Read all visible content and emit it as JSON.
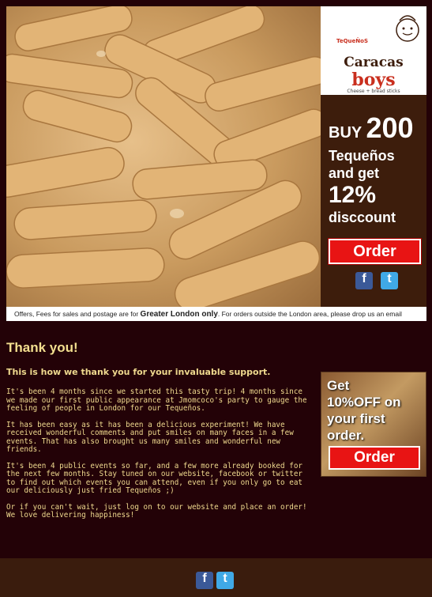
{
  "brand": {
    "tequenos_tag": "TeQueÑoS",
    "name_top": "Caracas",
    "name_bottom": "boys",
    "tagline": "Cheese + bread sticks"
  },
  "promo": {
    "buy": "BUY",
    "amount": "200",
    "product": "Tequeños",
    "and_get": "and get",
    "percent": "12%",
    "discount": "disccount",
    "order_label": "Order"
  },
  "social": {
    "facebook_glyph": "f",
    "twitter_glyph": "t"
  },
  "offer_note": {
    "before": "Offers, Fees for sales and postage are for ",
    "area": "Greater London only",
    "after": ". For orders outside the London area, please drop us an email"
  },
  "body": {
    "heading": "Thank you!",
    "lead": "This is how we thank you for your invaluable support.",
    "paragraphs": [
      "It's been 4 months since we started this tasty trip! 4 months since we made our first public appearance at Jmomcoco's party to gauge the feeling of people in London for our Tequeños.",
      "It has been easy as it has been a delicious experiment! We have received wonderful comments and put smiles on many faces in a few events. That has also brought us many smiles and wonderful new friends.",
      "It's been 4 public events so far, and a few more already booked for the next few months. Stay tuned on our website, facebook or twitter to find out which events you can attend, even if you only go to eat our deliciously just fried Tequeños ;)",
      "Or if you can't wait, just log on to our website and place an order! We love delivering happiness!"
    ]
  },
  "side_ad": {
    "line1": "Get",
    "line2": "10%OFF on",
    "line3": "your first",
    "line4": "order.",
    "order_label": "Order"
  },
  "colors": {
    "background": "#230207",
    "accent_red": "#e81414",
    "text_gold": "#efd98e",
    "brown": "#3d1d0c"
  }
}
